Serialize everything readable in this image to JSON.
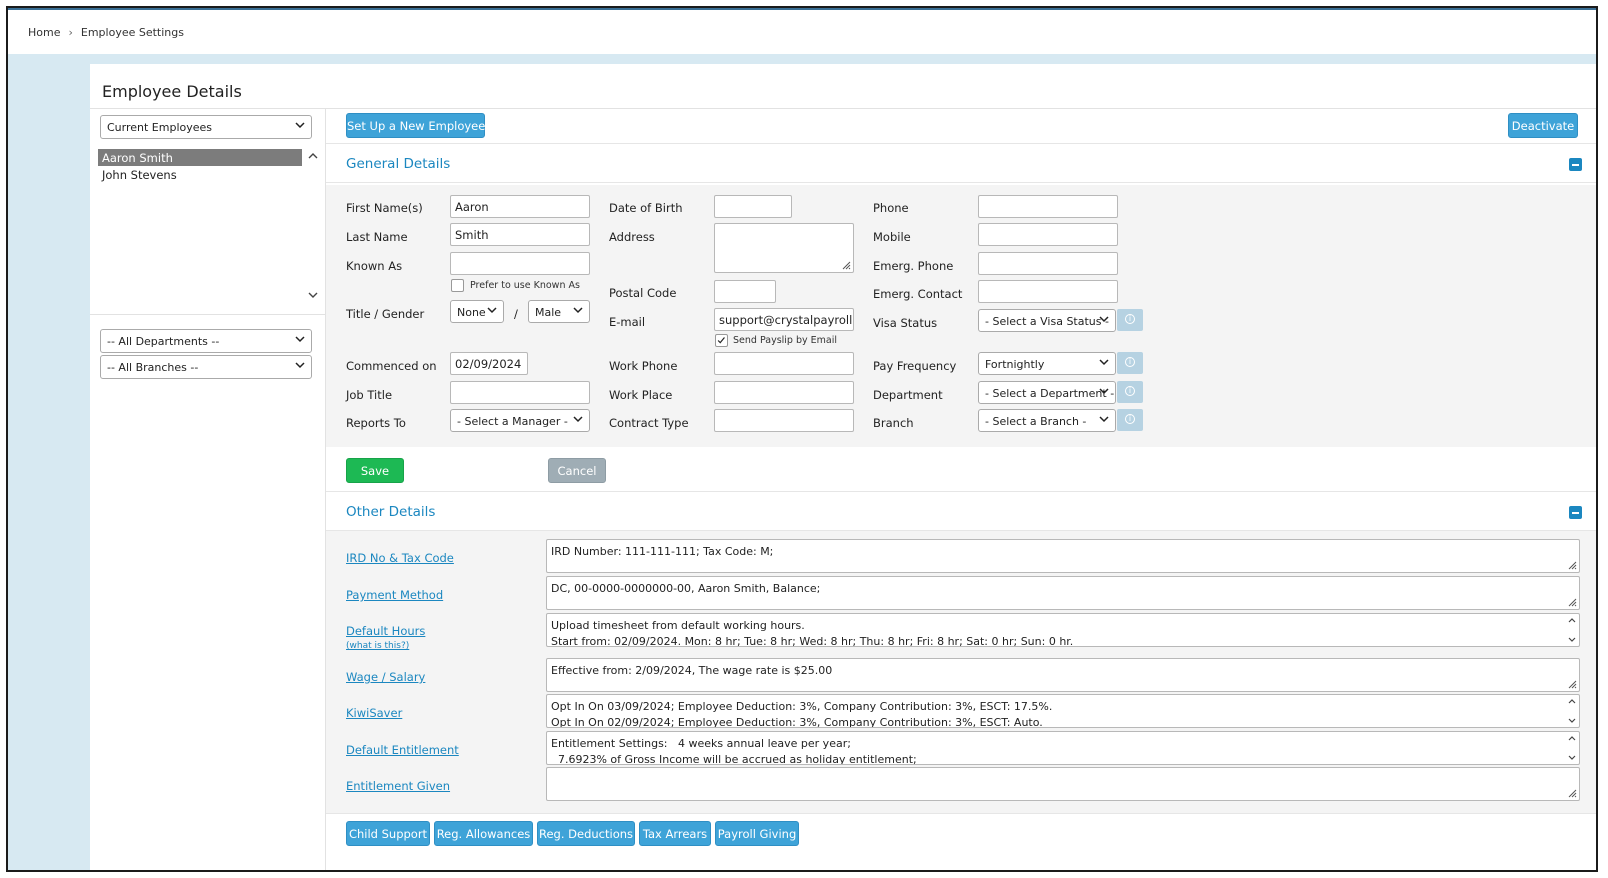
{
  "breadcrumb": {
    "home": "Home",
    "current": "Employee Settings"
  },
  "page_title": "Employee Details",
  "left": {
    "employee_filter": "Current Employees",
    "employees": [
      "Aaron Smith",
      "John Stevens"
    ],
    "selected_employee": "Aaron Smith",
    "department_filter": "-- All Departments --",
    "branch_filter": "-- All Branches --"
  },
  "toolbar": {
    "new_employee": "Set Up a New Employee",
    "deactivate": "Deactivate"
  },
  "general": {
    "title": "General Details",
    "first_name_label": "First Name(s)",
    "first_name": "Aaron",
    "last_name_label": "Last Name",
    "last_name": "Smith",
    "known_as_label": "Known As",
    "known_as": "",
    "prefer_known_as": "Prefer to use Known As",
    "title_gender_label": "Title / Gender",
    "title_value": "None",
    "slash": "/",
    "gender_value": "Male",
    "commenced_label": "Commenced on",
    "commenced": "02/09/2024",
    "job_title_label": "Job Title",
    "job_title": "",
    "reports_to_label": "Reports To",
    "reports_to": "- Select a Manager -",
    "dob_label": "Date of Birth",
    "dob": "",
    "address_label": "Address",
    "postal_code_label": "Postal Code",
    "postal_code": "",
    "email_label": "E-mail",
    "email": "support@crystalpayroll.co",
    "send_payslip": "Send Payslip by Email",
    "work_phone_label": "Work Phone",
    "work_place_label": "Work Place",
    "contract_type_label": "Contract Type",
    "phone_label": "Phone",
    "mobile_label": "Mobile",
    "emerg_phone_label": "Emerg. Phone",
    "emerg_contact_label": "Emerg. Contact",
    "visa_label": "Visa Status",
    "visa": "- Select a Visa Status -",
    "pay_freq_label": "Pay Frequency",
    "pay_freq": "Fortnightly",
    "department_label": "Department",
    "department": "- Select a Department -",
    "branch_label": "Branch",
    "branch": "- Select a Branch -",
    "save": "Save",
    "cancel": "Cancel"
  },
  "other": {
    "title": "Other Details",
    "rows": [
      {
        "label": "IRD No & Tax Code",
        "lines": [
          "IRD Number: 111-111-111; Tax Code: M;"
        ]
      },
      {
        "label": "Payment Method",
        "lines": [
          "DC, 00-0000-0000000-00, Aaron Smith, Balance;"
        ]
      },
      {
        "label": "Default Hours",
        "sub": "(what is this?)",
        "lines": [
          "Upload timesheet from default working hours.",
          "Start from: 02/09/2024. Mon: 8 hr; Tue: 8 hr; Wed: 8 hr; Thu: 8 hr; Fri: 8 hr; Sat: 0 hr; Sun: 0 hr."
        ]
      },
      {
        "label": "Wage / Salary",
        "lines": [
          "Effective from: 2/09/2024,  The wage rate is $25.00"
        ]
      },
      {
        "label": "KiwiSaver",
        "lines": [
          "Opt In On 03/09/2024; Employee Deduction: 3%, Company Contribution: 3%, ESCT: 17.5%.",
          "Opt In On 02/09/2024; Employee Deduction: 3%, Company Contribution: 3%, ESCT: Auto."
        ]
      },
      {
        "label": "Default Entitlement",
        "lines": [
          "Entitlement Settings:   4 weeks annual leave per year;",
          "  7.6923% of Gross Income will be accrued as holiday entitlement;"
        ]
      },
      {
        "label": "Entitlement Given",
        "lines": []
      }
    ]
  },
  "bottom_buttons": [
    "Child Support",
    "Reg. Allowances",
    "Reg. Deductions",
    "Tax Arrears",
    "Payroll Giving"
  ]
}
